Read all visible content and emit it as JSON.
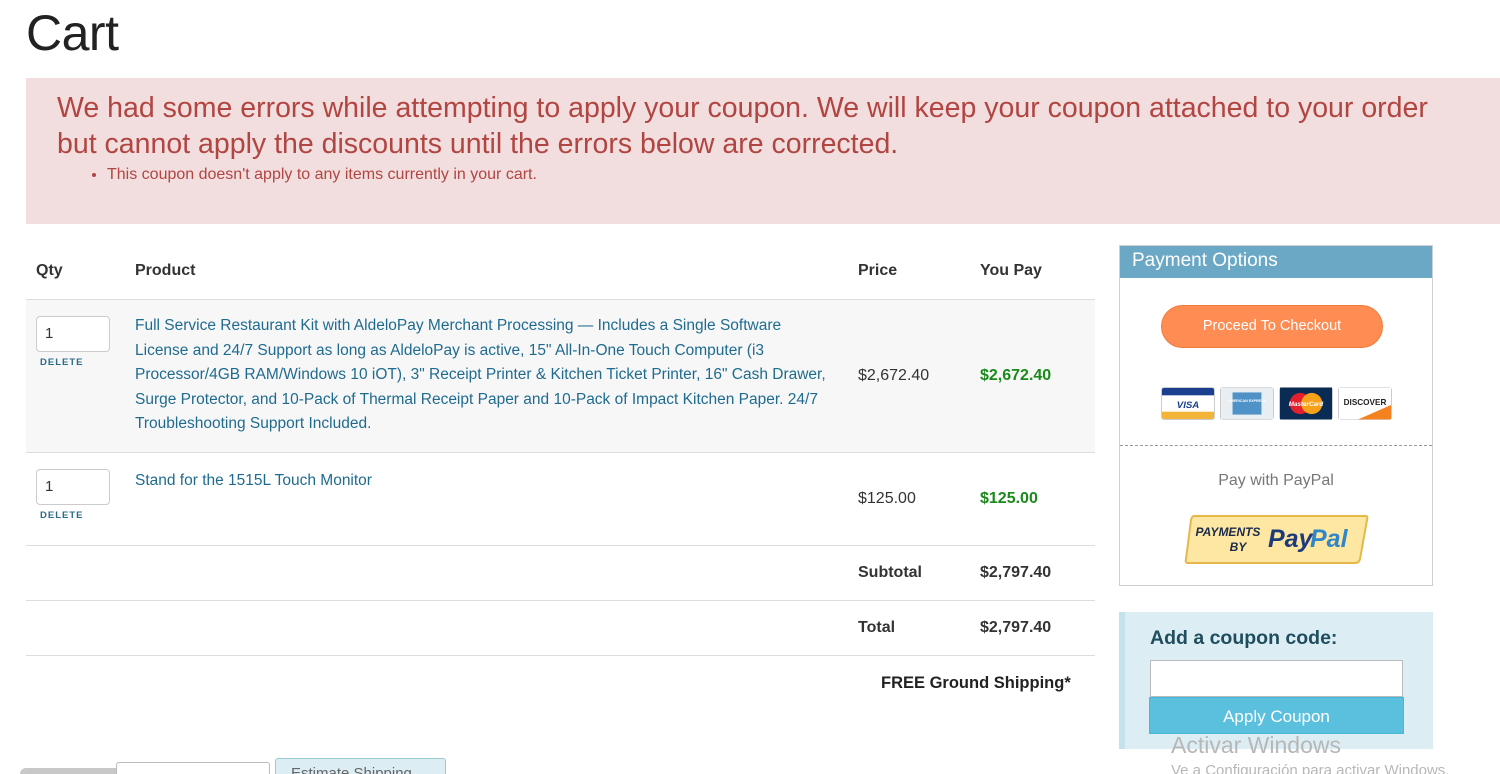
{
  "page": {
    "title": "Cart"
  },
  "alert": {
    "message_line1": "We had some errors while attempting to apply your coupon. We will keep your coupon attached to your order",
    "message_line2": "but cannot apply the discounts until the errors below are corrected.",
    "errors": [
      "This coupon doesn't apply to any items currently in your cart."
    ]
  },
  "table": {
    "headers": {
      "qty": "Qty",
      "product": "Product",
      "price": "Price",
      "you_pay": "You Pay"
    },
    "items": [
      {
        "qty": "1",
        "delete_label": "Delete",
        "product": "Full Service Restaurant Kit with AldeloPay Merchant Processing — Includes a Single Software License and 24/7 Support as long as AldeloPay is active, 15\" All-In-One Touch Computer (i3 Processor/4GB RAM/Windows 10 iOT), 3\" Receipt Printer & Kitchen Ticket Printer, 16\" Cash Drawer, Surge Protector, and 10-Pack of Thermal Receipt Paper and 10-Pack of Impact Kitchen Paper. 24/7 Troubleshooting Support Included.",
        "price": "$2,672.40",
        "you_pay": "$2,672.40"
      },
      {
        "qty": "1",
        "delete_label": "Delete",
        "product": "Stand for the 1515L Touch Monitor",
        "price": "$125.00",
        "you_pay": "$125.00"
      }
    ],
    "subtotal_label": "Subtotal",
    "subtotal_value": "$2,797.40",
    "total_label": "Total",
    "total_value": "$2,797.40"
  },
  "shipping_note": "FREE Ground Shipping*",
  "payment": {
    "header": "Payment Options",
    "checkout_label": "Proceed To Checkout",
    "cards": [
      "VISA",
      "AMERICAN EXPRESS",
      "MasterCard",
      "DISCOVER"
    ],
    "paypal_label": "Pay with PayPal",
    "paypal_badge_small": "PAYMENTS",
    "paypal_badge_by": "BY",
    "paypal_badge_brand_pay": "Pay",
    "paypal_badge_brand_pal": "Pal"
  },
  "coupon": {
    "title": "Add a coupon code:",
    "input_value": "",
    "apply_label": "Apply Coupon"
  },
  "watermark": {
    "title": "Activar Windows",
    "subtitle": "Ve a Configuración para activar Windows."
  },
  "bottom": {
    "button_label": "Estimate Shipping"
  },
  "colors": {
    "alert_bg": "#f2dede",
    "alert_text": "#b14542",
    "link": "#1f6b8f",
    "you_pay": "#1a8a1a",
    "checkout": "#ff8c52",
    "payment_header": "#6aa8c6",
    "apply_button": "#5bc0de"
  }
}
